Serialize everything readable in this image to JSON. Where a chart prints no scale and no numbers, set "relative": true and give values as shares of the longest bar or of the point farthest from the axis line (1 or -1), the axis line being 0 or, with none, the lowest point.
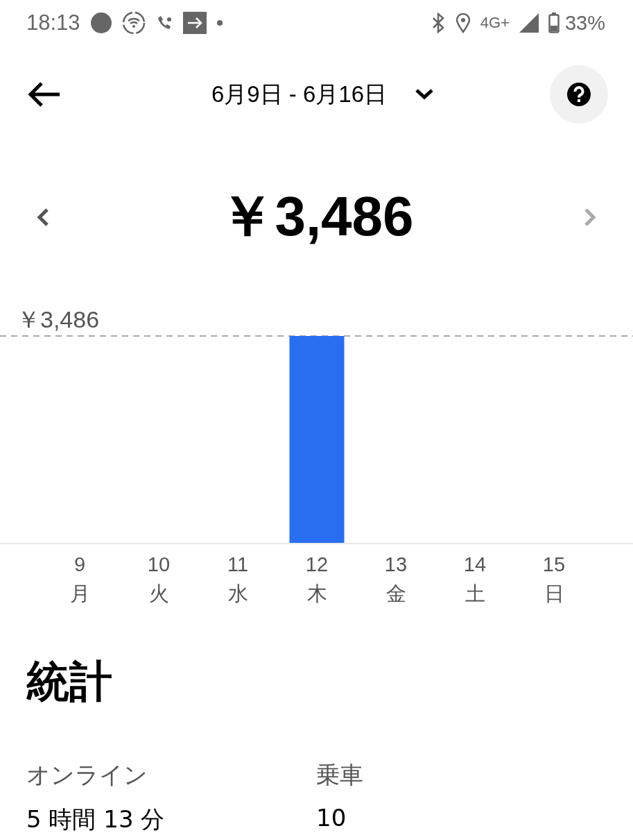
{
  "status_bar": {
    "time": "18:13",
    "network": "4G+",
    "battery": "33%"
  },
  "header": {
    "date_range": "6月9日 - 6月16日"
  },
  "summary": {
    "amount": "￥3,486"
  },
  "chart": {
    "chart_data": {
      "type": "bar",
      "relative": true,
      "categories": [
        "9",
        "10",
        "11",
        "12",
        "13",
        "14",
        "15"
      ],
      "values": [
        0,
        0,
        0,
        1,
        0,
        0,
        0
      ],
      "annotations": [
        {
          "text": "￥3,486"
        }
      ]
    },
    "weekdays": [
      "月",
      "火",
      "水",
      "木",
      "金",
      "土",
      "日"
    ]
  },
  "stats": {
    "title": "統計",
    "items": [
      {
        "label": "オンライン",
        "value": "5 時間 13 分"
      },
      {
        "label": "乗車",
        "value": "10"
      }
    ]
  }
}
